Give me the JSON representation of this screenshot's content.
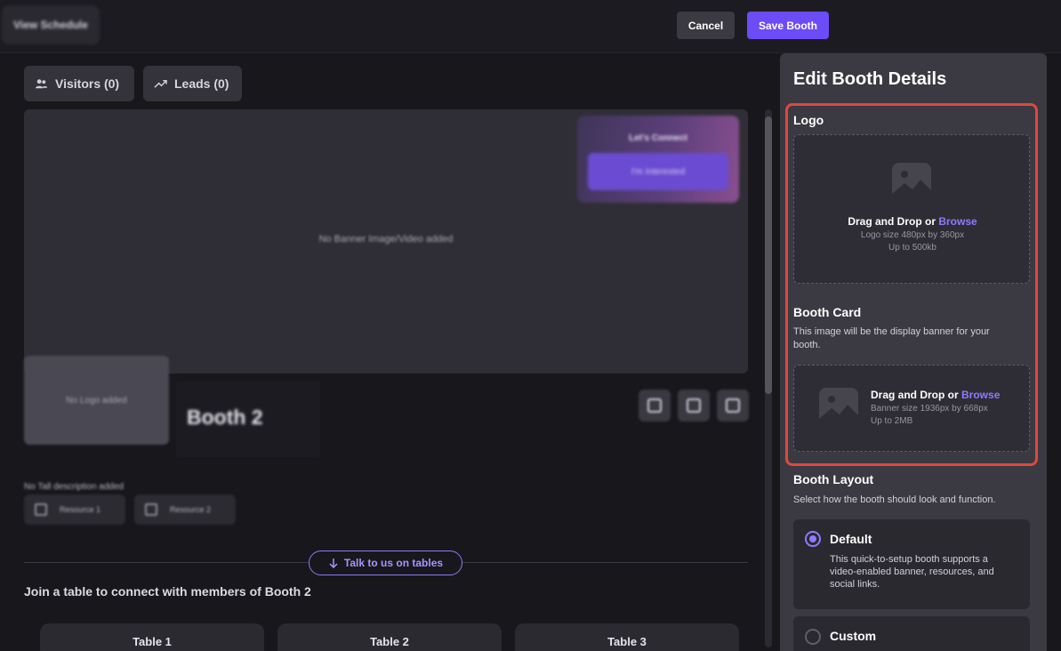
{
  "header": {
    "blurred_title": "View Schedule",
    "cancel_label": "Cancel",
    "save_label": "Save Booth"
  },
  "tabs": {
    "visitors_label": "Visitors (0)",
    "leads_label": "Leads (0)"
  },
  "preview": {
    "banner_placeholder": "No Banner Image/Video added",
    "cta_title": "Let's Connect",
    "cta_button": "I'm Interested",
    "logo_placeholder": "No Logo added",
    "booth_name": "Booth 2",
    "description_placeholder": "No Tall description added",
    "resources": [
      "Resource 1",
      "Resource 2"
    ],
    "talk_button": "Talk to us on tables",
    "join_text": "Join a table to connect with members of Booth 2",
    "tables": [
      "Table 1",
      "Table 2",
      "Table 3"
    ]
  },
  "panel": {
    "title": "Edit Booth Details",
    "logo": {
      "label": "Logo",
      "drop_text": "Drag and Drop or ",
      "browse": "Browse",
      "size_hint": "Logo size 480px by 360px",
      "limit_hint": "Up to 500kb"
    },
    "booth_card": {
      "label": "Booth Card",
      "description": "This image will be the display banner for your booth.",
      "drop_text": "Drag and Drop or ",
      "browse": "Browse",
      "size_hint": "Banner size 1936px by 668px",
      "limit_hint": "Up to 2MB"
    },
    "layout": {
      "label": "Booth Layout",
      "description": "Select how the booth should look and function.",
      "options": [
        {
          "title": "Default",
          "description": "This quick-to-setup booth supports a video-enabled banner, resources, and social links.",
          "selected": true
        },
        {
          "title": "Custom",
          "selected": false
        }
      ]
    }
  },
  "colors": {
    "accent": "#6b4cf6",
    "browse_link": "#8f7bff",
    "highlight_border": "#e0483c"
  }
}
